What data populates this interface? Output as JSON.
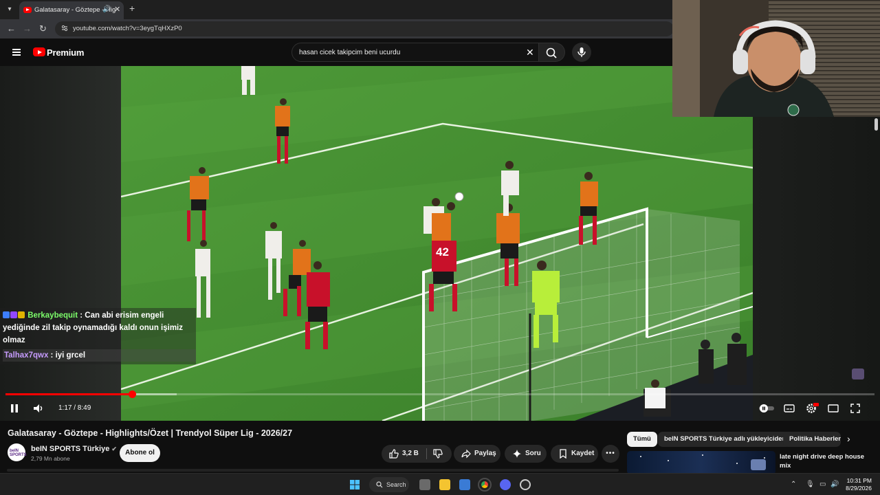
{
  "browser": {
    "tab_title": "Galatasaray - Göztepe - Hig",
    "url": "youtube.com/watch?v=3eygTqHXzP0"
  },
  "youtube": {
    "brand": "Premium",
    "search_value": "hasan cicek takipcim beni ucurdu"
  },
  "chat": [
    {
      "user": "Berkaybequit",
      "message_lines": [
        ": Can abi erisim engeli",
        "yediğinde zil takip oynamadığı kaldı onun işimiz",
        "olmaz"
      ]
    },
    {
      "user": "Talhax7qwx",
      "message_lines": [
        ": iyi grcel"
      ]
    }
  ],
  "player": {
    "time_display": "1:17 / 8:49",
    "progress_fraction": 0.146,
    "buffer_fraction": 0.197
  },
  "video": {
    "title": "Galatasaray - Göztepe - Highlights/Özet | Trendyol Süper Lig - 2026/27",
    "channel_name": "beIN SPORTS Türkiye",
    "channel_avatar_text": "beIN SPORTS",
    "subscribers": "2,79 Mn abone",
    "subscribe_label": "Abone ol",
    "likes": "3,2 B",
    "share_label": "Paylaş",
    "ask_label": "Soru",
    "save_label": "Kaydet",
    "jersey_number": "42"
  },
  "sidebar": {
    "chips": [
      "Tümü",
      "beIN SPORTS Türkiye adlı yükleyiciden",
      "Politika Haberleri"
    ],
    "rec_title": "late night drive deep house mix"
  },
  "taskbar": {
    "search_label": "Search",
    "time": "10:31 PM",
    "date": "8/29/2026"
  }
}
